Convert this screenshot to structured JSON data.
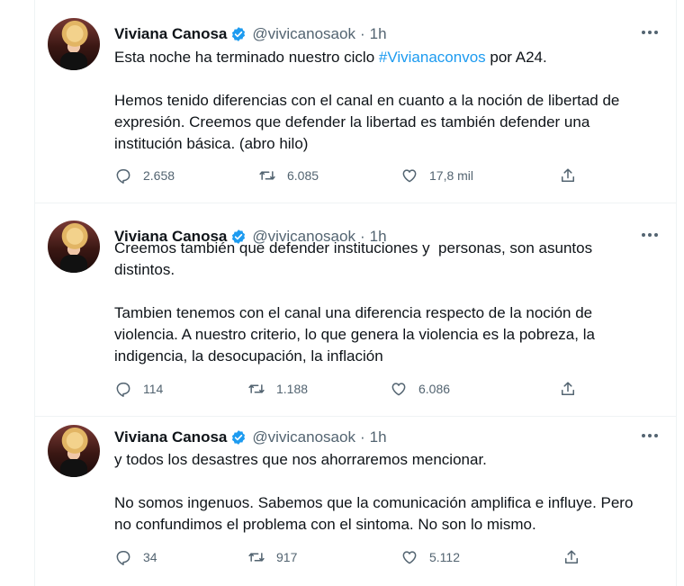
{
  "tweets": [
    {
      "name": "Viviana Canosa",
      "handle": "@vivicanosaok",
      "separator": "·",
      "time": "1h",
      "text_before": "Esta noche ha terminado nuestro ciclo ",
      "hashtag": "#Vivianaconvos",
      "text_after": " por A24.\n\nHemos tenido diferencias con el canal en cuanto a la noción de libertad de expresión. Creemos que defender la libertad es también defender una institución básica. (abro hilo)",
      "replies": "2.658",
      "retweets": "6.085",
      "likes": "17,8 mil"
    },
    {
      "name": "Viviana Canosa",
      "handle": "@vivicanosaok",
      "separator": "·",
      "time": "1h",
      "text": "Creemos también que defender instituciones y  personas, son asuntos distintos.\n\nTambien tenemos con el canal una diferencia respecto de la noción de violencia. A nuestro criterio, lo que genera la violencia es la pobreza, la indigencia, la desocupación, la inflación",
      "replies": "114",
      "retweets": "1.188",
      "likes": "6.086"
    },
    {
      "name": "Viviana Canosa",
      "handle": "@vivicanosaok",
      "separator": "·",
      "time": "1h",
      "text": "y todos los desastres que nos ahorraremos mencionar.\n\nNo somos ingenuos. Sabemos que la comunicación amplifica e influye. Pero no confundimos el problema con el sintoma. No son lo mismo.",
      "replies": "34",
      "retweets": "917",
      "likes": "5.112"
    }
  ],
  "icons": {
    "verified": "verified-badge-icon",
    "more": "more-icon",
    "reply": "reply-icon",
    "retweet": "retweet-icon",
    "like": "like-icon",
    "share": "share-icon"
  },
  "colors": {
    "link": "#1d9bf0",
    "secondary_text": "#536471",
    "verified": "#1d9bf0"
  }
}
